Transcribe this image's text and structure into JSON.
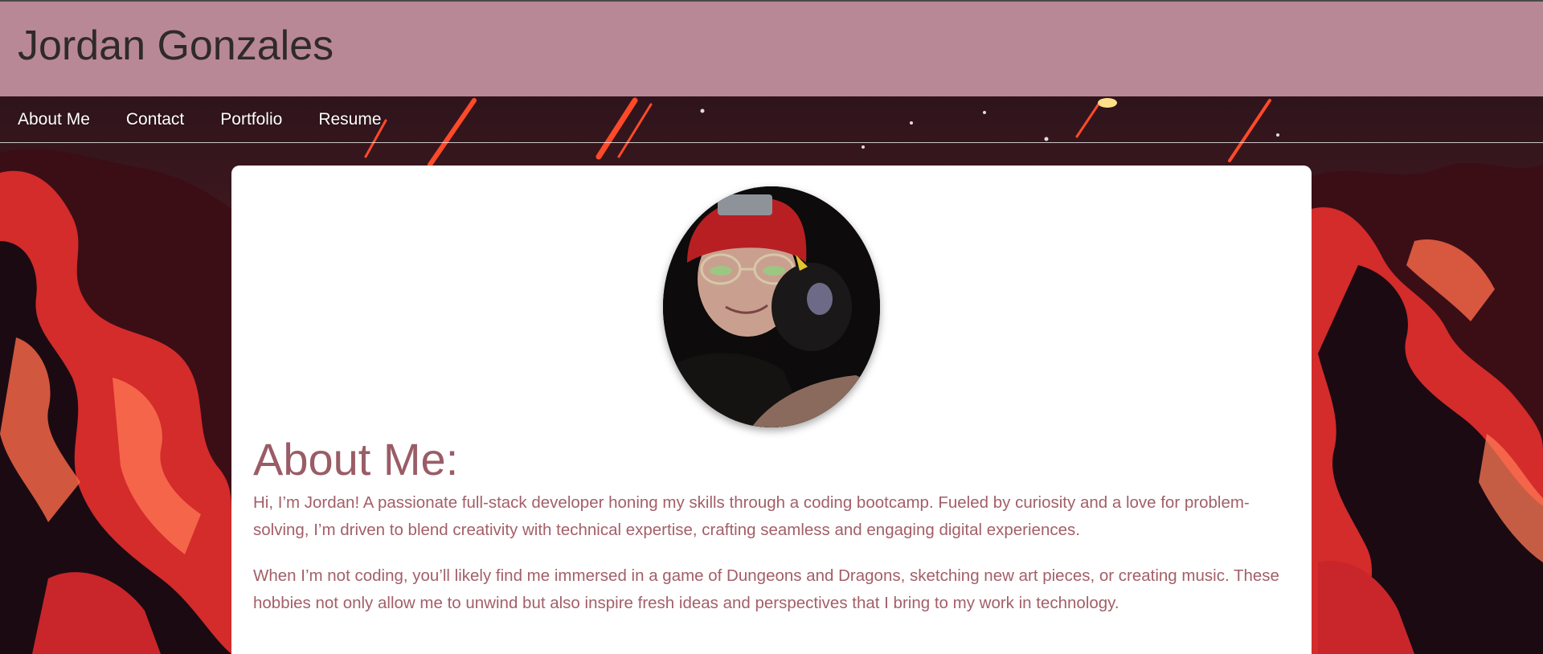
{
  "header": {
    "site_title": "Jordan Gonzales"
  },
  "nav": {
    "items": [
      {
        "label": "About Me"
      },
      {
        "label": "Contact"
      },
      {
        "label": "Portfolio"
      },
      {
        "label": "Resume"
      }
    ]
  },
  "about": {
    "heading": "About Me:",
    "paragraphs": [
      "Hi, I’m Jordan! A passionate full-stack developer honing my skills through a coding bootcamp. Fueled by curiosity and a love for problem-solving, I’m driven to blend creativity with technical expertise, crafting seamless and engaging digital experiences.",
      "When I’m not coding, you’ll likely find me immersed in a game of Dungeons and Dragons, sketching new art pieces, or creating music. These hobbies not only allow me to unwind but also inspire fresh ideas and perspectives that I bring to my work in technology."
    ]
  },
  "colors": {
    "header_bg": "#b98896",
    "title_text": "#2f2a2c",
    "accent_text": "#9a5c66",
    "nav_text": "#ffffff",
    "card_bg": "#ffffff"
  }
}
